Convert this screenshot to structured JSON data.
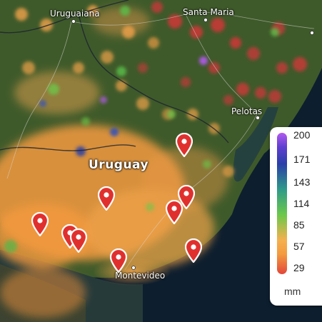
{
  "places": [
    {
      "name": "Uruguaiana",
      "kind": "city"
    },
    {
      "name": "Santa Maria",
      "kind": "city"
    },
    {
      "name": "Pelotas",
      "kind": "city"
    },
    {
      "name": "Montevideo",
      "kind": "city"
    },
    {
      "name": "Uruguay",
      "kind": "country"
    }
  ],
  "legend": {
    "ticks": [
      "200",
      "171",
      "143",
      "114",
      "85",
      "57",
      "29"
    ],
    "unit": "mm",
    "colors": [
      "#b45af0",
      "#2a3fa8",
      "#6bc84a",
      "#f5b04e",
      "#e2463a"
    ]
  },
  "pins": {
    "count": 10,
    "color": "#e0302e",
    "icon": "map-pin-icon"
  },
  "colors": {
    "ocean": "#0d1e2e",
    "land": "#3f5a2a",
    "dry": "#f39a3f",
    "wet": "#e2463a"
  }
}
